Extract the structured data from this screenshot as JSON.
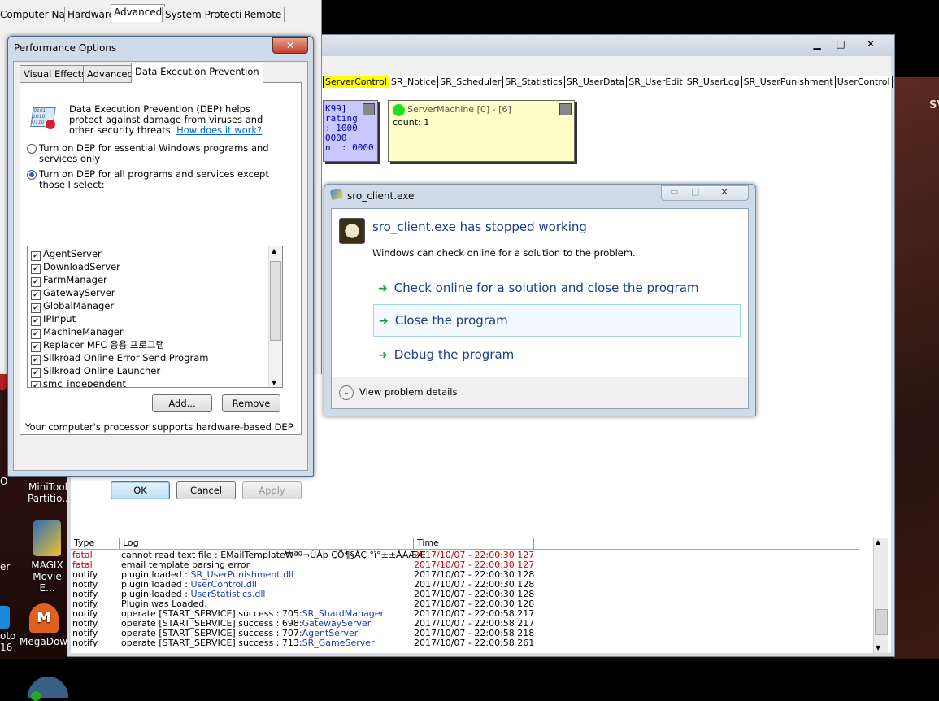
{
  "desktop": {
    "corner_text": "SV",
    "icons": [
      {
        "label": "MiniTool Partitio...",
        "color": "#c0392b"
      },
      {
        "label": "MAGIX Movie E...",
        "color": "#2d6fb5"
      },
      {
        "label": "MegaDow...",
        "color": "#e06020"
      }
    ],
    "left_edge_labels": [
      "O",
      "er",
      "oto",
      "16"
    ]
  },
  "sysprops": {
    "tabs": [
      "Computer Name",
      "Hardware",
      "Advanced",
      "System Protection",
      "Remote"
    ],
    "active_tab": "Advanced"
  },
  "perf": {
    "title": "Performance Options",
    "close": "✕",
    "tabs": [
      "Visual Effects",
      "Advanced",
      "Data Execution Prevention"
    ],
    "desc": "Data Execution Prevention (DEP) helps protect against damage from viruses and other security threats.",
    "link": "How does it work?",
    "radio1": "Turn on DEP for essential Windows programs and services only",
    "radio2": "Turn on DEP for all programs and services except those I select:",
    "list": [
      "AgentServer",
      "DownloadServer",
      "FarmManager",
      "GatewayServer",
      "GlobalManager",
      "IPInput",
      "MachineManager",
      "Replacer MFC 응용 프로그램",
      "Silkroad Online Error Send Program",
      "Silkroad Online Launcher",
      "smc_independent"
    ],
    "add": "Add...",
    "remove": "Remove",
    "support": "Your computer's processor supports hardware-based DEP.",
    "ok": "OK",
    "cancel": "Cancel",
    "apply": "Apply"
  },
  "mainwin": {
    "min": "▁",
    "max": "□",
    "close": "✕",
    "tabs": [
      "ServerControl",
      "SR_Notice",
      "SR_Scheduler",
      "SR_Statistics",
      "SR_UserData",
      "SR_UserEdit",
      "SR_UserLog",
      "SR_UserPunishment",
      "UserControl"
    ],
    "box1": [
      "K99]",
      "rating",
      ": 1000",
      "0000",
      "nt : 0000"
    ],
    "box2_title": "ServerMachine [0] - [6]",
    "box2_count": "count: 1"
  },
  "log": {
    "headers": [
      "Type",
      "Log",
      "Time"
    ],
    "rows": [
      {
        "type": "fatal",
        "pre": "cannot read text file : EMailTemplate₩ªº¬ÙÀþ ÇÖ¶§ÀÇ °î°±±ÁÁÆÆ",
        "link": "",
        "time": "2017/10/07 - 22:00:30 127",
        "color": "#cc0000"
      },
      {
        "type": "fatal",
        "pre": "email template parsing error",
        "link": "",
        "time": "2017/10/07 - 22:00:30 127",
        "color": "#cc0000"
      },
      {
        "type": "notify",
        "pre": "plugin loaded : ",
        "link": "SR_UserPunishment.dll",
        "time": "2017/10/07 - 22:00:30 128",
        "color": "#000000"
      },
      {
        "type": "notify",
        "pre": "plugin loaded : ",
        "link": "UserControl.dll",
        "time": "2017/10/07 - 22:00:30 128",
        "color": "#000000"
      },
      {
        "type": "notify",
        "pre": "plugin loaded : ",
        "link": "UserStatistics.dll",
        "time": "2017/10/07 - 22:00:30 128",
        "color": "#000000"
      },
      {
        "type": "notify",
        "pre": "Plugin was Loaded.",
        "link": "",
        "time": "2017/10/07 - 22:00:30 128",
        "color": "#000000"
      },
      {
        "type": "notify",
        "pre": "operate [START_SERVICE] success : 705:",
        "link": "SR_ShardManager",
        "time": "2017/10/07 - 22:00:58 217",
        "color": "#000000"
      },
      {
        "type": "notify",
        "pre": "operate [START_SERVICE] success : 698:",
        "link": "GatewayServer",
        "time": "2017/10/07 - 22:00:58 217",
        "color": "#000000"
      },
      {
        "type": "notify",
        "pre": "operate [START_SERVICE] success : 707:",
        "link": "AgentServer",
        "time": "2017/10/07 - 22:00:58 218",
        "color": "#000000"
      },
      {
        "type": "notify",
        "pre": "operate [START_SERVICE] success : 713:",
        "link": "SR_GameServer",
        "time": "2017/10/07 - 22:00:58 261",
        "color": "#000000"
      }
    ]
  },
  "crash": {
    "title": "sro_client.exe",
    "heading": "sro_client.exe has stopped working",
    "sub": "Windows can check online for a solution to the problem.",
    "options": [
      "Check online for a solution and close the program",
      "Close the program",
      "Debug the program"
    ],
    "details": "View problem details"
  }
}
